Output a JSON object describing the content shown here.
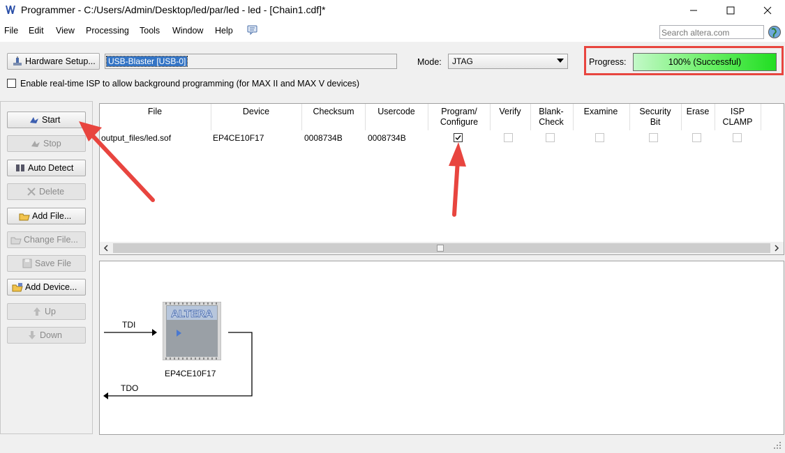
{
  "window": {
    "title": "Programmer - C:/Users/Admin/Desktop/led/par/led - led - [Chain1.cdf]*",
    "controls": [
      "minimize",
      "maximize",
      "close"
    ]
  },
  "menu": {
    "items": [
      "File",
      "Edit",
      "View",
      "Processing",
      "Tools",
      "Window",
      "Help"
    ],
    "search_placeholder": "Search altera.com"
  },
  "toolbar": {
    "hardware_setup_label": "Hardware Setup...",
    "hardware_value": "USB-Blaster [USB-0]",
    "mode_label": "Mode:",
    "mode_value": "JTAG",
    "progress_label": "Progress:",
    "progress_text": "100% (Successful)",
    "progress_fraction": 1.0,
    "isp_label": "Enable real-time ISP to allow background programming (for MAX II and MAX V devices)",
    "isp_checked": false
  },
  "left_buttons": {
    "start": "Start",
    "stop": "Stop",
    "auto_detect": "Auto Detect",
    "delete": "Delete",
    "add_file": "Add File...",
    "change_file": "Change File...",
    "save_file": "Save File",
    "add_device": "Add Device...",
    "up": "Up",
    "down": "Down"
  },
  "table": {
    "columns": {
      "file": "File",
      "device": "Device",
      "checksum": "Checksum",
      "usercode": "Usercode",
      "program_1": "Program/",
      "program_2": "Configure",
      "verify": "Verify",
      "blank_1": "Blank-",
      "blank_2": "Check",
      "examine": "Examine",
      "security_1": "Security",
      "security_2": "Bit",
      "erase": "Erase",
      "isp_1": "ISP",
      "isp_2": "CLAMP"
    },
    "row": {
      "file": "output_files/led.sof",
      "device": "EP4CE10F17",
      "checksum": "0008734B",
      "usercode": "0008734B",
      "program_configure": true,
      "verify": false,
      "blank_check": false,
      "examine": false,
      "security_bit": false,
      "erase": false,
      "isp_clamp": false
    }
  },
  "chain": {
    "tdi_label": "TDI",
    "tdo_label": "TDO",
    "device_name": "EP4CE10F17",
    "chip_logo": "ALTERA"
  },
  "colors": {
    "annotation_red": "#e8453f",
    "progress_green": "#21de22",
    "selection_blue": "#3374c5"
  }
}
